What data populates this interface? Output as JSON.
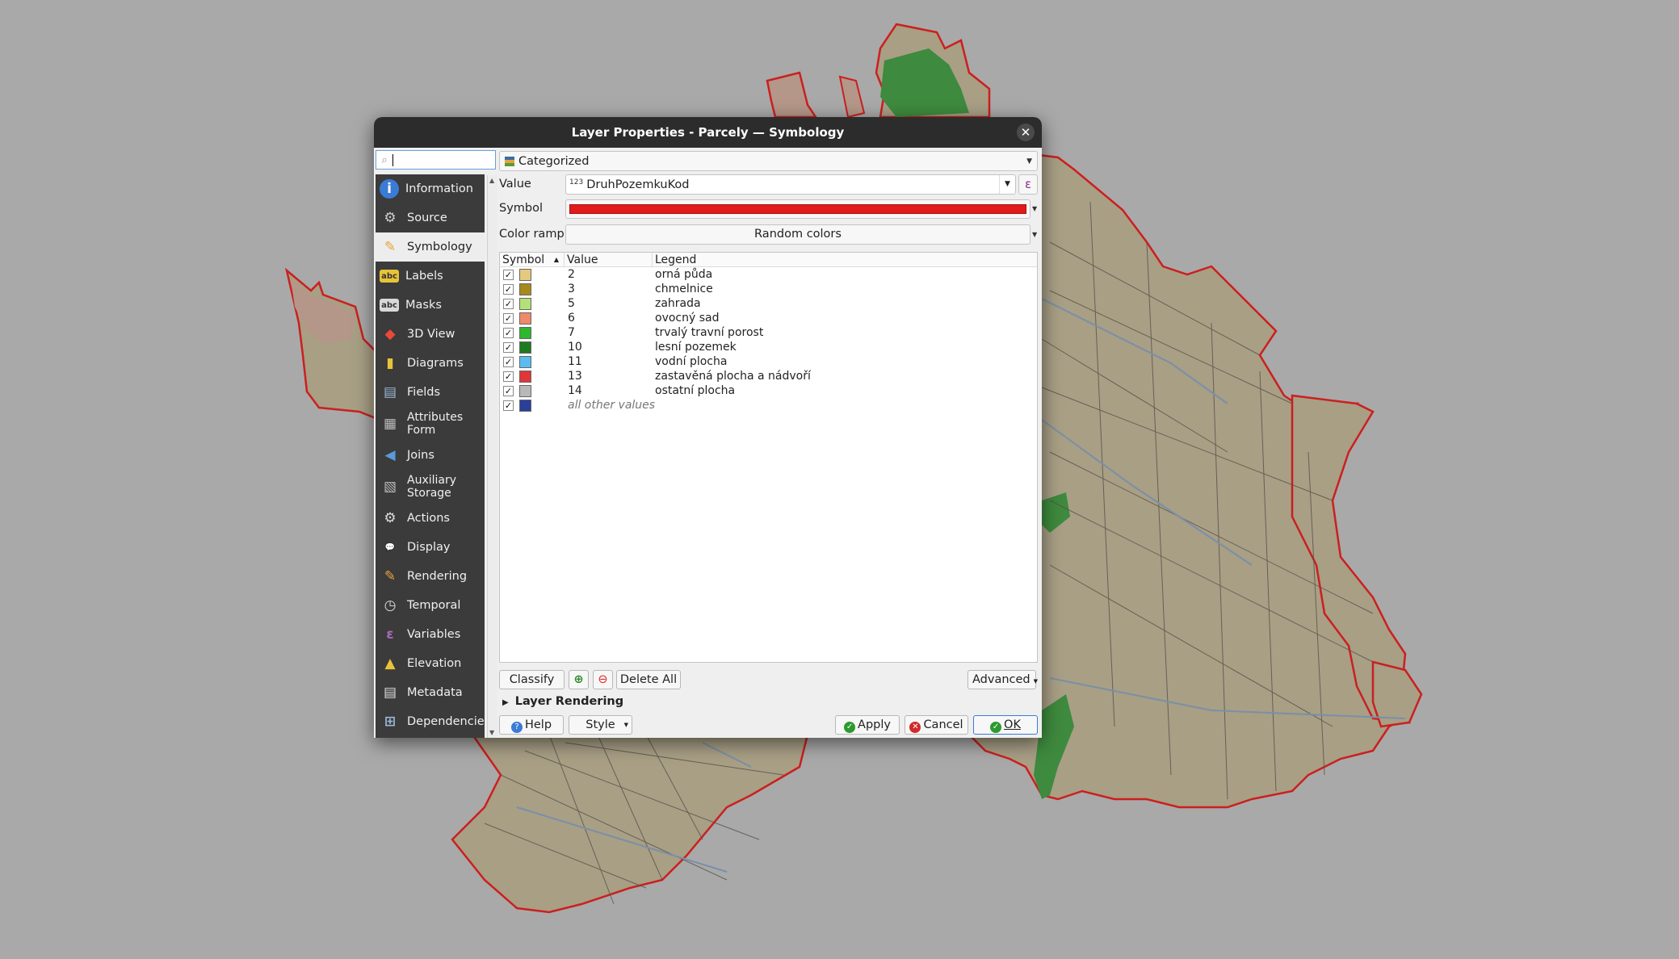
{
  "dialog": {
    "title": "Layer Properties - Parcely — Symbology",
    "close_label": "✕"
  },
  "sidebar": {
    "search_placeholder": "",
    "items": [
      {
        "label": "Information",
        "icon": "information-icon"
      },
      {
        "label": "Source",
        "icon": "source-icon"
      },
      {
        "label": "Symbology",
        "icon": "symbology-icon",
        "active": true
      },
      {
        "label": "Labels",
        "icon": "labels-icon"
      },
      {
        "label": "Masks",
        "icon": "masks-icon"
      },
      {
        "label": "3D View",
        "icon": "3d-view-icon"
      },
      {
        "label": "Diagrams",
        "icon": "diagrams-icon"
      },
      {
        "label": "Fields",
        "icon": "fields-icon"
      },
      {
        "label": "Attributes\nForm",
        "icon": "attributes-form-icon"
      },
      {
        "label": "Joins",
        "icon": "joins-icon"
      },
      {
        "label": "Auxiliary\nStorage",
        "icon": "auxiliary-storage-icon"
      },
      {
        "label": "Actions",
        "icon": "actions-icon"
      },
      {
        "label": "Display",
        "icon": "display-icon"
      },
      {
        "label": "Rendering",
        "icon": "rendering-icon"
      },
      {
        "label": "Temporal",
        "icon": "temporal-icon"
      },
      {
        "label": "Variables",
        "icon": "variables-icon"
      },
      {
        "label": "Elevation",
        "icon": "elevation-icon"
      },
      {
        "label": "Metadata",
        "icon": "metadata-icon"
      },
      {
        "label": "Dependencies",
        "icon": "dependencies-icon"
      }
    ]
  },
  "renderer": {
    "selected": "Categorized",
    "value_label": "Value",
    "value_field": "DruhPozemkuKod",
    "value_field_type": "123",
    "symbol_label": "Symbol",
    "symbol_color": "#e31a1c",
    "color_ramp_label": "Color ramp",
    "color_ramp_value": "Random colors"
  },
  "categories": {
    "headers": {
      "symbol": "Symbol",
      "value": "Value",
      "legend": "Legend"
    },
    "rows": [
      {
        "value": "2",
        "legend": "orná půda",
        "color": "#e5c97f"
      },
      {
        "value": "3",
        "legend": "chmelnice",
        "color": "#a88a1a"
      },
      {
        "value": "5",
        "legend": "zahrada",
        "color": "#b4e07a"
      },
      {
        "value": "6",
        "legend": "ovocný sad",
        "color": "#f0896a"
      },
      {
        "value": "7",
        "legend": "trvalý travní porost",
        "color": "#2db82d"
      },
      {
        "value": "10",
        "legend": "lesní pozemek",
        "color": "#1e7a1e"
      },
      {
        "value": "11",
        "legend": "vodní plocha",
        "color": "#5bbcf0"
      },
      {
        "value": "13",
        "legend": "zastavěná plocha a nádvoří",
        "color": "#e0363a"
      },
      {
        "value": "14",
        "legend": "ostatní plocha",
        "color": "#b8b8b8"
      },
      {
        "value": "all other values",
        "legend": "",
        "color": "#2a3f9a",
        "other": true
      }
    ]
  },
  "buttons": {
    "classify": "Classify",
    "delete_all": "Delete All",
    "advanced": "Advanced",
    "layer_rendering": "Layer Rendering",
    "help": "Help",
    "style": "Style",
    "apply": "Apply",
    "cancel": "Cancel",
    "ok": "OK"
  },
  "colors": {
    "map_background": "#a9a9a9",
    "parcel_fill": "#a89f85",
    "parcel_outline": "#cc1f1f",
    "forest": "#3e8a3e"
  }
}
